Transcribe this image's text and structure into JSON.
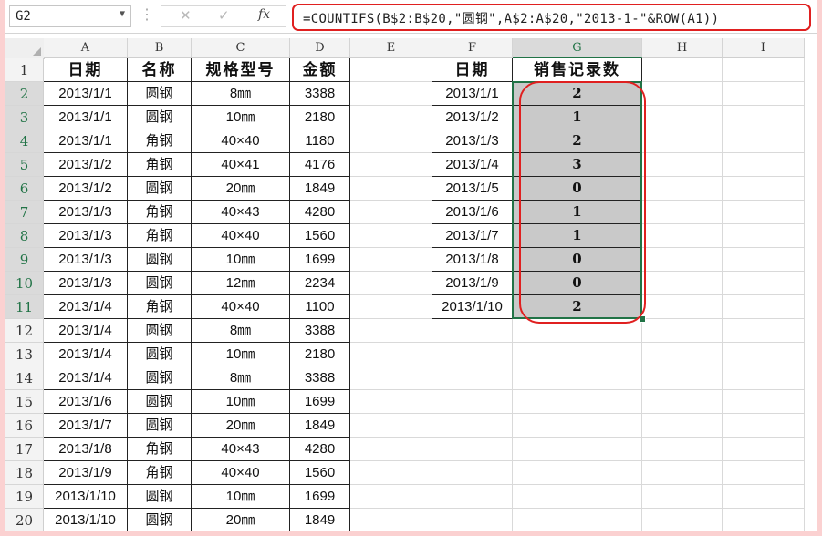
{
  "name_box": "G2",
  "formula_bar": {
    "cancel_glyph": "✕",
    "enter_glyph": "✓",
    "fx_label": "fx",
    "formula": "=COUNTIFS(B$2:B$20,\"圆钢\",A$2:A$20,\"2013-1-\"&ROW(A1))"
  },
  "columns": [
    "A",
    "B",
    "C",
    "D",
    "E",
    "F",
    "G",
    "H",
    "I"
  ],
  "rows": [
    "1",
    "2",
    "3",
    "4",
    "5",
    "6",
    "7",
    "8",
    "9",
    "10",
    "11",
    "12",
    "13",
    "14",
    "15",
    "16",
    "17",
    "18",
    "19",
    "20"
  ],
  "table_left": {
    "headers": [
      "日期",
      "名称",
      "规格型号",
      "金额"
    ],
    "rows": [
      [
        "2013/1/1",
        "圆钢",
        "8㎜",
        "3388"
      ],
      [
        "2013/1/1",
        "圆钢",
        "10㎜",
        "2180"
      ],
      [
        "2013/1/1",
        "角钢",
        "40×40",
        "1180"
      ],
      [
        "2013/1/2",
        "角钢",
        "40×41",
        "4176"
      ],
      [
        "2013/1/2",
        "圆钢",
        "20㎜",
        "1849"
      ],
      [
        "2013/1/3",
        "角钢",
        "40×43",
        "4280"
      ],
      [
        "2013/1/3",
        "角钢",
        "40×40",
        "1560"
      ],
      [
        "2013/1/3",
        "圆钢",
        "10㎜",
        "1699"
      ],
      [
        "2013/1/3",
        "圆钢",
        "12㎜",
        "2234"
      ],
      [
        "2013/1/4",
        "角钢",
        "40×40",
        "1100"
      ],
      [
        "2013/1/4",
        "圆钢",
        "8㎜",
        "3388"
      ],
      [
        "2013/1/4",
        "圆钢",
        "10㎜",
        "2180"
      ],
      [
        "2013/1/4",
        "圆钢",
        "8㎜",
        "3388"
      ],
      [
        "2013/1/6",
        "圆钢",
        "10㎜",
        "1699"
      ],
      [
        "2013/1/7",
        "圆钢",
        "20㎜",
        "1849"
      ],
      [
        "2013/1/8",
        "角钢",
        "40×43",
        "4280"
      ],
      [
        "2013/1/9",
        "角钢",
        "40×40",
        "1560"
      ],
      [
        "2013/1/10",
        "圆钢",
        "10㎜",
        "1699"
      ],
      [
        "2013/1/10",
        "圆钢",
        "20㎜",
        "1849"
      ]
    ]
  },
  "table_right": {
    "headers": [
      "日期",
      "销售记录数"
    ],
    "rows": [
      [
        "2013/1/1",
        "2"
      ],
      [
        "2013/1/2",
        "1"
      ],
      [
        "2013/1/3",
        "2"
      ],
      [
        "2013/1/4",
        "3"
      ],
      [
        "2013/1/5",
        "0"
      ],
      [
        "2013/1/6",
        "1"
      ],
      [
        "2013/1/7",
        "1"
      ],
      [
        "2013/1/8",
        "0"
      ],
      [
        "2013/1/9",
        "0"
      ],
      [
        "2013/1/10",
        "2"
      ]
    ]
  },
  "colors": {
    "highlight_red": "#e02020",
    "selection_green": "#217346",
    "selected_fill": "#c9c9c9",
    "page_border_pink": "#fbd1d1"
  }
}
